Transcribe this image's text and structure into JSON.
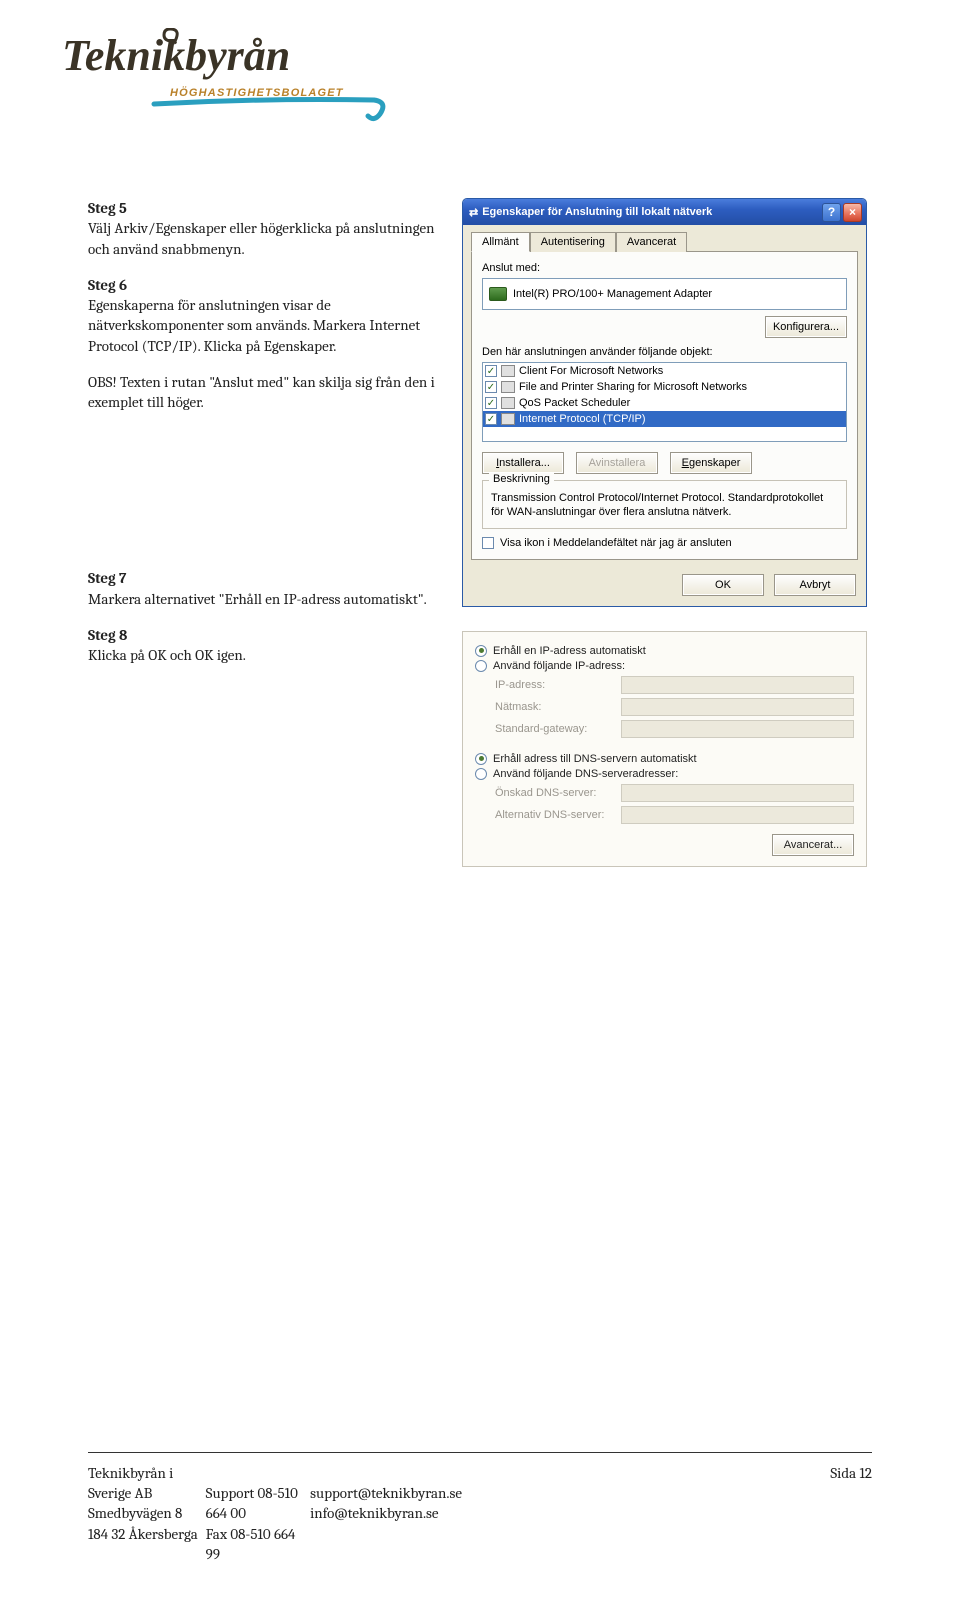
{
  "logo": {
    "main": "Teknikbyrån",
    "sub": "HÖGHASTIGHETSBOLAGET"
  },
  "steps": {
    "s5": {
      "title": "Steg 5",
      "body": "Välj Arkiv/Egenskaper eller högerklicka på anslutningen och använd snabbmenyn."
    },
    "s6": {
      "title": "Steg 6",
      "body1": "Egenskaperna för anslutningen visar de nätverkskomponenter som används. Markera Internet Protocol (TCP/IP). Klicka på Egenskaper.",
      "body2": "OBS! Texten i rutan \"Anslut med\" kan skilja sig från den i exemplet till höger."
    },
    "s7": {
      "title": "Steg 7",
      "body": "Markera alternativet \"Erhåll en IP-adress automatiskt\"."
    },
    "s8": {
      "title": "Steg 8",
      "body": "Klicka på OK och OK igen."
    }
  },
  "dialog": {
    "title": "Egenskaper för Anslutning till lokalt nätverk",
    "help": "?",
    "close": "×",
    "tabs": {
      "t1": "Allmänt",
      "t2": "Autentisering",
      "t3": "Avancerat"
    },
    "connect_label": "Anslut med:",
    "adapter": "Intel(R) PRO/100+ Management Adapter",
    "configure": "Konfigurera...",
    "uses_label": "Den här anslutningen använder följande objekt:",
    "items": {
      "i1": "Client For Microsoft Networks",
      "i2": "File and Printer Sharing for Microsoft Networks",
      "i3": "QoS Packet Scheduler",
      "i4": "Internet Protocol (TCP/IP)"
    },
    "install": "Installera...",
    "uninstall": "Avinstallera",
    "props": "Egenskaper",
    "desc_legend": "Beskrivning",
    "desc_text": "Transmission Control Protocol/Internet Protocol. Standardprotokollet för WAN-anslutningar över flera anslutna nätverk.",
    "tray_cb": "Visa ikon i Meddelandefältet när jag är ansluten",
    "ok": "OK",
    "cancel": "Avbryt"
  },
  "ip": {
    "r1": "Erhåll en IP-adress automatiskt",
    "r2": "Använd följande IP-adress:",
    "ip": "IP-adress:",
    "mask": "Nätmask:",
    "gw": "Standard-gateway:",
    "r3": "Erhåll adress till DNS-servern automatiskt",
    "r4": "Använd följande DNS-serveradresser:",
    "dns1": "Önskad DNS-server:",
    "dns2": "Alternativ DNS-server:",
    "adv": "Avancerat..."
  },
  "footer": {
    "company": "Teknikbyrån i Sverige AB",
    "addr1": "Smedbyvägen 8",
    "addr2": "184 32 Åkersberga",
    "support_label": "Support 08-510 664 00",
    "fax_label": "Fax 08-510 664 99",
    "email1": "support@teknikbyran.se",
    "email2": "info@teknikbyran.se",
    "page": "Sida 12"
  }
}
